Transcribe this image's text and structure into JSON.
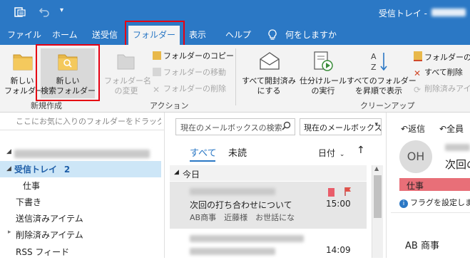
{
  "window": {
    "title": "受信トレイ -"
  },
  "tabs": [
    {
      "label": "ファイル"
    },
    {
      "label": "ホーム"
    },
    {
      "label": "送受信"
    },
    {
      "label": "フォルダー"
    },
    {
      "label": "表示"
    },
    {
      "label": "ヘルプ"
    }
  ],
  "tell_me": "何をしますか",
  "ribbon": {
    "new_folder": {
      "line1": "新しい",
      "line2": "フォルダー"
    },
    "new_search_folder": {
      "line1": "新しい",
      "line2": "検索フォルダー"
    },
    "rename_folder": {
      "line1": "フォルダー名",
      "line2": "の変更"
    },
    "copy_folder": "フォルダーのコピー",
    "move_folder": "フォルダーの移動",
    "delete_folder": "フォルダーの削除",
    "mark_all_read": {
      "line1": "すべて開封済み",
      "line2": "にする"
    },
    "run_rules": {
      "line1": "仕分けルール",
      "line2": "の実行"
    },
    "sort_ascending": {
      "line1": "すべてのフォルダー",
      "line2": "を昇順で表示"
    },
    "folder_cleanup": "フォルダーのク",
    "delete_all": "すべて削除",
    "empty_deleted": "削除済みアイテ",
    "group_new": "新規作成",
    "group_actions": "アクション",
    "group_cleanup": "クリーンアップ"
  },
  "folder_pane": {
    "favorites_hint": "ここにお気に入りのフォルダーをドラッグしま",
    "inbox_label": "受信トレイ",
    "inbox_count": "2",
    "folders": [
      "仕事",
      "下書き",
      "送信済みアイテム",
      "削除済みアイテム",
      "RSS フィード"
    ]
  },
  "message_list": {
    "search_placeholder": "現在のメールボックスの検索",
    "scope": "現在のメールボックス",
    "filter_all": "すべて",
    "filter_unread": "未読",
    "sort_by": "日付",
    "group_today": "今日",
    "messages": [
      {
        "subject": "次回の打ち合わせについて",
        "preview": "AB商事　近藤様　お世話にな",
        "time": "15:00"
      },
      {
        "subject": "",
        "preview": "",
        "time": "14:09"
      }
    ]
  },
  "reading_pane": {
    "reply": "返信",
    "reply_all": "全員",
    "avatar_initials": "OH",
    "subject_partial": "次回の",
    "category": "仕事",
    "flag_notice": "フラグを設定しま",
    "body_partial": "AB 商事"
  }
}
